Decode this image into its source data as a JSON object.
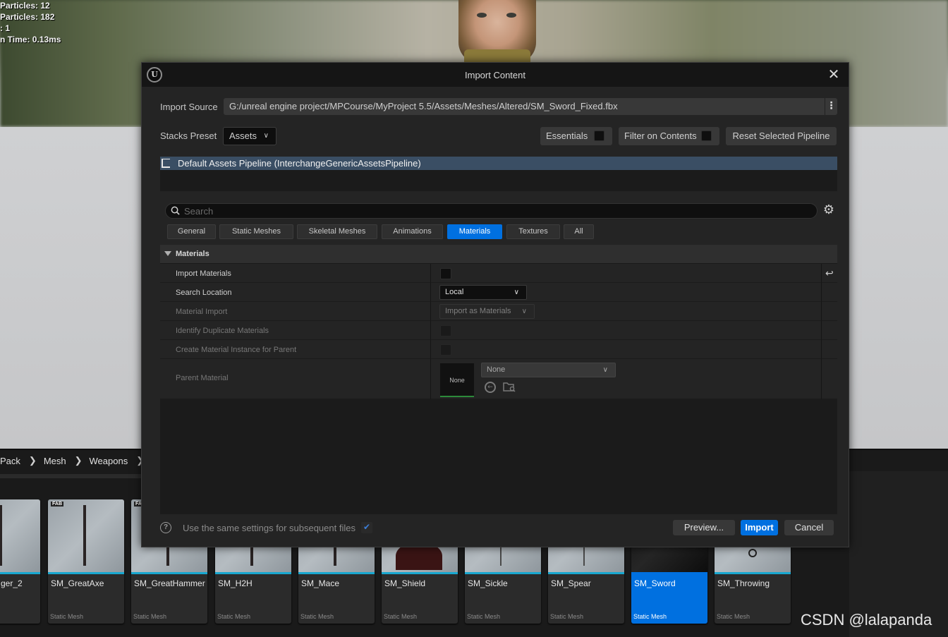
{
  "viewport": {
    "stats": [
      "Particles: 12",
      "Particles: 182",
      ": 1",
      "n Time: 0.13ms"
    ]
  },
  "dialog": {
    "title": "Import Content",
    "import_source": {
      "label": "Import Source",
      "value": "G:/unreal engine project/MPCourse/MyProject 5.5/Assets/Meshes/Altered/SM_Sword_Fixed.fbx"
    },
    "stacks_preset": {
      "label": "Stacks Preset",
      "value": "Assets"
    },
    "essentials_label": "Essentials",
    "filter_label": "Filter on Contents",
    "reset_label": "Reset Selected Pipeline",
    "pipeline": "Default Assets Pipeline (InterchangeGenericAssetsPipeline)",
    "search_placeholder": "Search",
    "tabs": [
      "General",
      "Static Meshes",
      "Skeletal Meshes",
      "Animations",
      "Materials",
      "Textures",
      "All"
    ],
    "active_tab": "Materials",
    "section": "Materials",
    "properties": {
      "import_materials": {
        "label": "Import Materials",
        "checked": false
      },
      "search_location": {
        "label": "Search Location",
        "value": "Local"
      },
      "material_import": {
        "label": "Material Import",
        "value": "Import as Materials"
      },
      "identify_duplicates": {
        "label": "Identify Duplicate Materials",
        "checked": false
      },
      "create_instance": {
        "label": "Create Material Instance for Parent",
        "checked": false
      },
      "parent_material": {
        "label": "Parent Material",
        "thumb_text": "None",
        "value": "None"
      }
    },
    "footer": {
      "same_settings_label": "Use the same settings for subsequent files",
      "same_settings_checked": true,
      "preview_label": "Preview...",
      "import_label": "Import",
      "cancel_label": "Cancel"
    }
  },
  "content_browser": {
    "breadcrumb": [
      "Pack",
      "Mesh",
      "Weapons"
    ],
    "tiles": [
      {
        "name": "ger_2",
        "type": ""
      },
      {
        "name": "SM_GreatAxe",
        "type": "Static Mesh"
      },
      {
        "name": "SM_GreatHammer",
        "type": "Static Mesh"
      },
      {
        "name": "SM_H2H",
        "type": "Static Mesh"
      },
      {
        "name": "SM_Mace",
        "type": "Static Mesh"
      },
      {
        "name": "SM_Shield",
        "type": "Static Mesh"
      },
      {
        "name": "SM_Sickle",
        "type": "Static Mesh"
      },
      {
        "name": "SM_Spear",
        "type": "Static Mesh"
      },
      {
        "name": "SM_Sword",
        "type": "Static Mesh"
      },
      {
        "name": "SM_Throwing",
        "type": "Static Mesh"
      }
    ],
    "selected_tile": "SM_Sword",
    "thumb_tag": "FAB"
  },
  "watermark": "CSDN @lalapanda",
  "colors": {
    "accent": "#0070e0",
    "tile_underline": "#18a7cf",
    "selected_row": "#3a4e64"
  }
}
